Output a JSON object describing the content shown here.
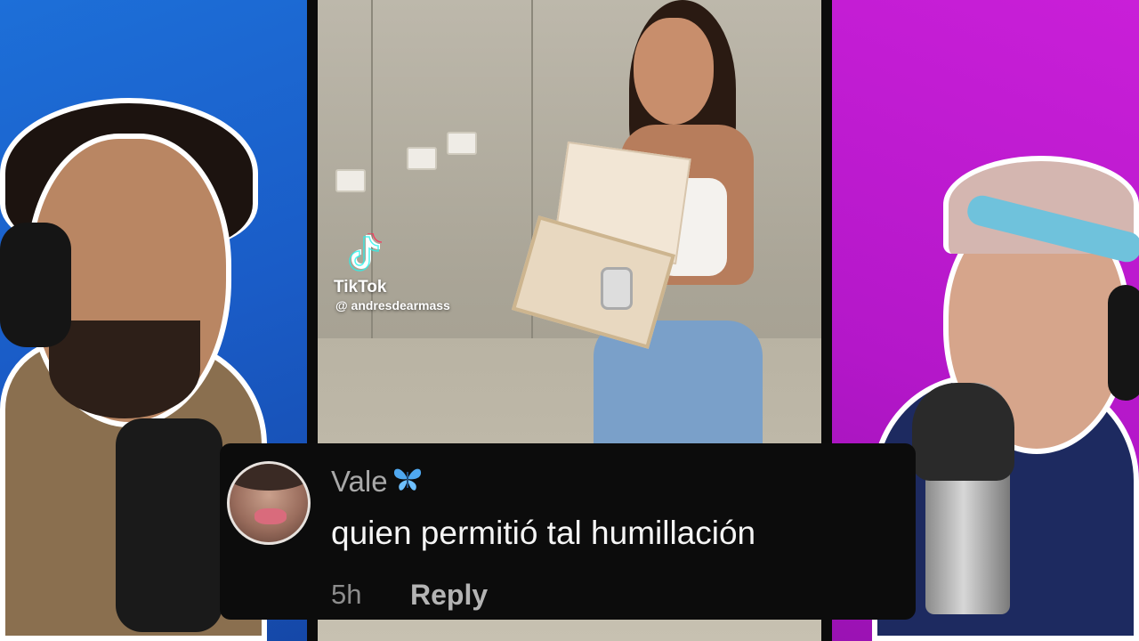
{
  "video": {
    "platform": "TikTok",
    "username": "@ andresdearmass"
  },
  "comment": {
    "username": "Vale",
    "text": "quien permitió tal humillación",
    "time": "5h",
    "reply_label": "Reply",
    "username_badge_icon": "butterfly-icon"
  },
  "colors": {
    "left_bg": "#1a5cc7",
    "right_bg": "#b417c9",
    "comment_bg": "#0c0c0c"
  }
}
